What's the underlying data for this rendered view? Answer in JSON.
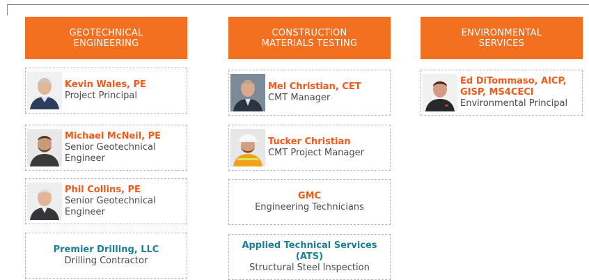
{
  "columns": [
    {
      "header": [
        "GEOTECHNICAL",
        "ENGINEERING"
      ],
      "cards": [
        {
          "name": "Kevin Wales, PE",
          "role": [
            "Project Principal"
          ],
          "photo": "person-photo"
        },
        {
          "name": "Michael McNeil, PE",
          "role": [
            "Senior Geotechnical",
            "Engineer"
          ],
          "photo": "person-photo"
        },
        {
          "name": "Phil Collins, PE",
          "role": [
            "Senior Geotechnical",
            "Engineer"
          ],
          "photo": "person-photo"
        },
        {
          "name": "Premier Drilling, LLC",
          "role": [
            "Drilling Contractor"
          ],
          "photo": null
        }
      ]
    },
    {
      "header": [
        "CONSTRUCTION",
        "MATERIALS TESTING"
      ],
      "cards": [
        {
          "name": "Mel Christian, CET",
          "role": [
            "CMT Manager"
          ],
          "photo": "person-photo"
        },
        {
          "name": "Tucker Christian",
          "role": [
            "CMT Project Manager"
          ],
          "photo": "person-photo"
        },
        {
          "name": "GMC",
          "role": [
            "Engineering Technicians"
          ],
          "photo": null
        },
        {
          "name": [
            "Applied Technical Services",
            "(ATS)"
          ],
          "role": [
            "Structural Steel Inspection"
          ],
          "photo": null
        }
      ]
    },
    {
      "header": [
        "ENVIRONMENTAL",
        "SERVICES"
      ],
      "cards": [
        {
          "name": [
            "Ed DiTommaso, AICP,",
            "GISP, MS4CECI"
          ],
          "role": [
            "Environmental Principal"
          ],
          "photo": "person-photo"
        }
      ]
    }
  ],
  "colors": {
    "header_bg": "#f37021",
    "name_orange": "#f05a1a",
    "name_teal": "#1c7f95"
  }
}
